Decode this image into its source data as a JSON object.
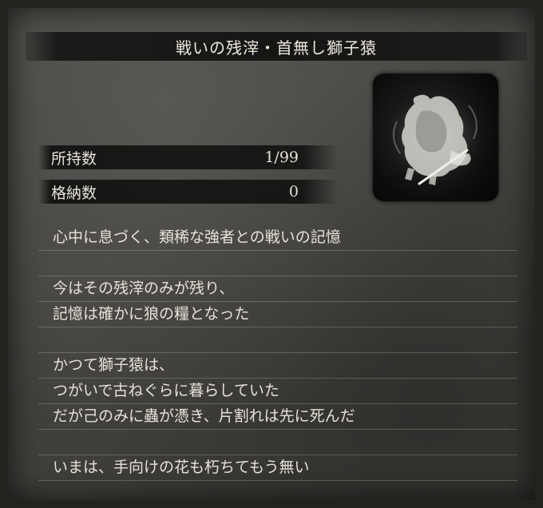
{
  "title": "戦いの残滓・首無し獅子猿",
  "portrait": {
    "icon": "headless-ape-icon"
  },
  "stats": [
    {
      "label": "所持数",
      "value": "1/99"
    },
    {
      "label": "格納数",
      "value": "0"
    }
  ],
  "description": [
    "心中に息づく、類稀な強者との戦いの記憶",
    "",
    "今はその残滓のみが残り、",
    "記憶は確かに狼の糧となった",
    "",
    "かつて獅子猿は、",
    "つがいで古ねぐらに暮らしていた",
    "だが己のみに蟲が憑き、片割れは先に死んだ",
    "",
    "いまは、手向けの花も朽ちてもう無い"
  ]
}
